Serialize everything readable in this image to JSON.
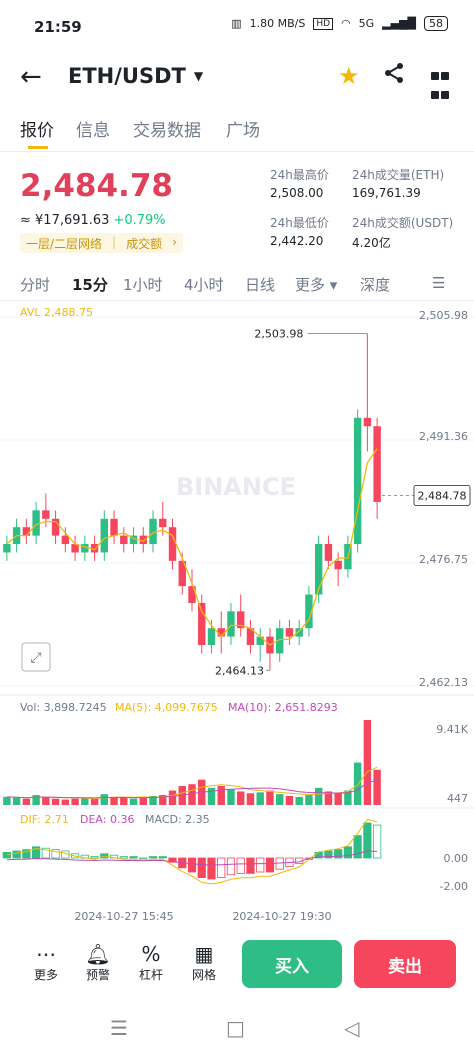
{
  "status": {
    "time": "21:59",
    "net_speed": "1.80 MB/S",
    "hd": "HD",
    "signal": "5G",
    "battery": "58"
  },
  "header": {
    "pair": "ETH/USDT"
  },
  "tabs": [
    {
      "label": "报价",
      "active": true
    },
    {
      "label": "信息",
      "active": false
    },
    {
      "label": "交易数据",
      "active": false
    },
    {
      "label": "广场",
      "active": false
    }
  ],
  "ticker": {
    "price": "2,484.78",
    "fiat": "≈ ¥17,691.63",
    "change": "+0.79%",
    "tag_layer": "一层/二层网络",
    "tag_volume": "成交额",
    "high_label": "24h最高价",
    "high": "2,508.00",
    "low_label": "24h最低价",
    "low": "2,442.20",
    "vol_eth_label": "24h成交量(ETH)",
    "vol_eth": "169,761.39",
    "vol_usdt_label": "24h成交额(USDT)",
    "vol_usdt": "4.20亿"
  },
  "intervals": [
    {
      "label": "分时",
      "active": false
    },
    {
      "label": "15分",
      "active": true
    },
    {
      "label": "1小时",
      "active": false
    },
    {
      "label": "4小时",
      "active": false
    },
    {
      "label": "日线",
      "active": false
    },
    {
      "label": "更多 ▾",
      "active": false
    },
    {
      "label": "深度",
      "active": false
    }
  ],
  "chart_data": {
    "type": "candlestick",
    "avl_label": "AVL 2,488.75",
    "watermark": "BINANCE",
    "y_ticks": [
      "2,505.98",
      "2,491.36",
      "2,476.75",
      "2,462.13"
    ],
    "y_range": [
      2462.13,
      2505.98
    ],
    "high_marker": "2,503.98",
    "low_marker": "2,464.13",
    "last_price": "2,484.78",
    "candles": [
      [
        2478,
        2480,
        2477,
        2479
      ],
      [
        2479,
        2482,
        2478,
        2481
      ],
      [
        2481,
        2482,
        2479,
        2480
      ],
      [
        2480,
        2484,
        2479,
        2483
      ],
      [
        2483,
        2485,
        2481,
        2482
      ],
      [
        2482,
        2483,
        2479,
        2480
      ],
      [
        2480,
        2481,
        2478,
        2479
      ],
      [
        2479,
        2480,
        2477,
        2478
      ],
      [
        2478,
        2480,
        2477,
        2479
      ],
      [
        2479,
        2480,
        2477,
        2478
      ],
      [
        2478,
        2483,
        2477,
        2482
      ],
      [
        2482,
        2483,
        2479,
        2480
      ],
      [
        2480,
        2481,
        2478,
        2479
      ],
      [
        2479,
        2481,
        2478,
        2480
      ],
      [
        2480,
        2481,
        2478,
        2479
      ],
      [
        2479,
        2483,
        2478,
        2482
      ],
      [
        2482,
        2484,
        2480,
        2481
      ],
      [
        2481,
        2482,
        2476,
        2477
      ],
      [
        2477,
        2478,
        2473,
        2474
      ],
      [
        2474,
        2476,
        2471,
        2472
      ],
      [
        2472,
        2473,
        2466,
        2467
      ],
      [
        2467,
        2470,
        2466,
        2469
      ],
      [
        2469,
        2471,
        2466,
        2468
      ],
      [
        2468,
        2472,
        2467,
        2471
      ],
      [
        2471,
        2473,
        2468,
        2469
      ],
      [
        2469,
        2470,
        2466,
        2467
      ],
      [
        2467,
        2469,
        2465,
        2468
      ],
      [
        2468,
        2469,
        2464,
        2466
      ],
      [
        2466,
        2470,
        2465,
        2469
      ],
      [
        2469,
        2470,
        2467,
        2468
      ],
      [
        2468,
        2470,
        2467,
        2469
      ],
      [
        2469,
        2474,
        2468,
        2473
      ],
      [
        2473,
        2480,
        2472,
        2479
      ],
      [
        2479,
        2480,
        2476,
        2477
      ],
      [
        2477,
        2478,
        2474,
        2476
      ],
      [
        2476,
        2480,
        2475,
        2479
      ],
      [
        2479,
        2495,
        2478,
        2494
      ],
      [
        2494,
        2504,
        2490,
        2493
      ],
      [
        2493,
        2494,
        2482,
        2484
      ]
    ],
    "volume": {
      "label": "Vol: 3,898.7245",
      "ma5": "MA(5): 4,099.7675",
      "ma10": "MA(10): 2,651.8293",
      "y_ticks": [
        "9.41K",
        "447"
      ],
      "values": [
        900,
        800,
        700,
        1100,
        900,
        700,
        600,
        700,
        800,
        700,
        1200,
        900,
        800,
        700,
        900,
        1000,
        1100,
        1600,
        2100,
        2300,
        2800,
        1900,
        2100,
        1700,
        1500,
        1300,
        1400,
        1600,
        1200,
        1000,
        900,
        1100,
        1900,
        1500,
        1300,
        1600,
        4700,
        9410,
        3898
      ]
    },
    "macd": {
      "dif": "DIF: 2.71",
      "dea": "DEA: 0.36",
      "macd": "MACD: 2.35",
      "y_ticks": [
        "0.00",
        "-2.00"
      ],
      "hist": [
        0.4,
        0.5,
        0.6,
        0.8,
        0.7,
        0.6,
        0.5,
        0.3,
        0.2,
        0.1,
        0.3,
        0.2,
        0.1,
        0.1,
        0.0,
        0.1,
        0.1,
        -0.3,
        -0.7,
        -1.0,
        -1.4,
        -1.5,
        -1.4,
        -1.2,
        -1.1,
        -1.1,
        -1.0,
        -1.0,
        -0.8,
        -0.6,
        -0.4,
        -0.1,
        0.4,
        0.5,
        0.6,
        0.8,
        1.6,
        2.5,
        2.35
      ]
    },
    "time_labels": [
      "2024-10-27 15:45",
      "2024-10-27 19:30"
    ]
  },
  "bottom": {
    "more": "更多",
    "alert": "预警",
    "leverage": "杠杆",
    "grid": "网格",
    "buy": "买入",
    "sell": "卖出"
  },
  "colors": {
    "up": "#2ebd85",
    "down": "#f6465d",
    "accent": "#f0b90b"
  }
}
